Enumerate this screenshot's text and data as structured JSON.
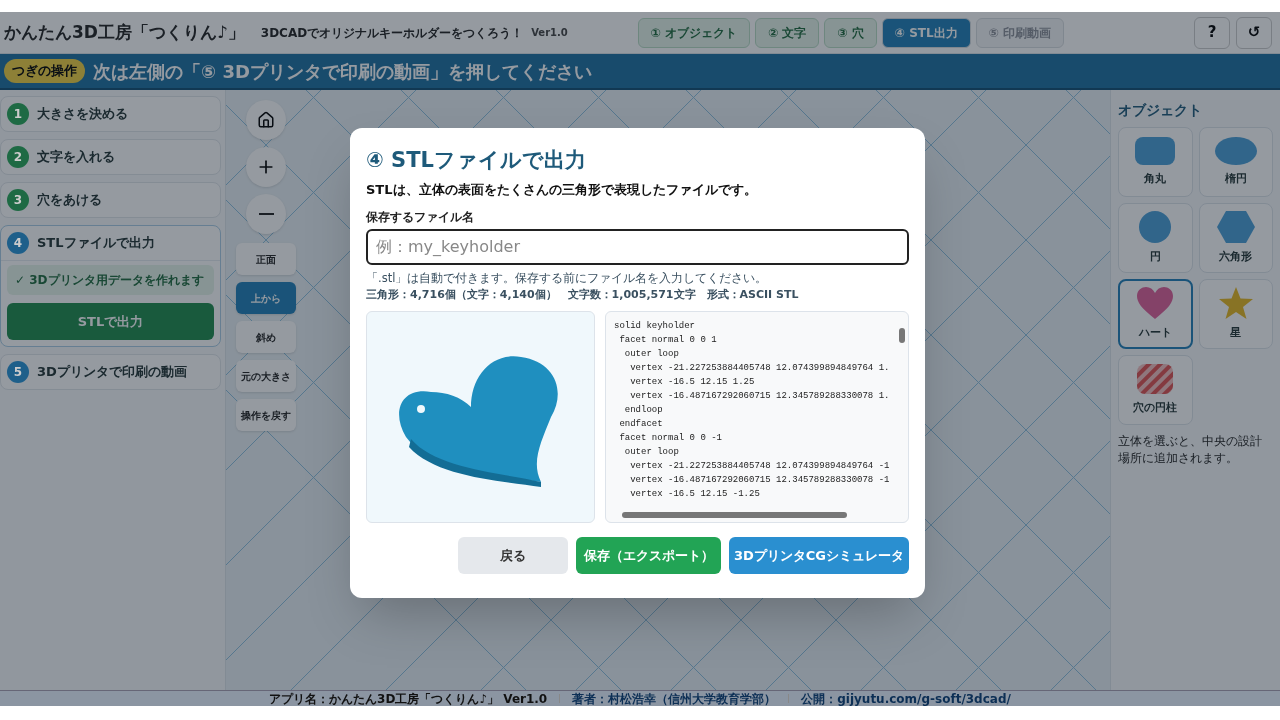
{
  "header": {
    "title": "かんたん3D工房「つくりん♪」",
    "subtitle": "3DCADでオリジナルキーホルダーをつくろう！",
    "version": "Ver1.0",
    "tabs": [
      {
        "label": "① オブジェクト",
        "selected": false,
        "done": true
      },
      {
        "label": "② 文字",
        "selected": false,
        "done": true
      },
      {
        "label": "③ 穴",
        "selected": false,
        "done": true
      },
      {
        "label": "④ STL出力",
        "selected": true,
        "done": false
      },
      {
        "label": "⑤ 印刷動画",
        "selected": false,
        "done": false
      }
    ],
    "help": "?",
    "reset": "↺"
  },
  "banner": {
    "badge": "つぎの操作",
    "message": "次は左側の「⑤ 3Dプリンタで印刷の動画」を押してください"
  },
  "steps": [
    {
      "number": "1",
      "label": "大きさを決める",
      "color": "#1e6a44",
      "expanded": false
    },
    {
      "number": "2",
      "label": "文字を入れる",
      "color": "#1e6a44",
      "expanded": false
    },
    {
      "number": "3",
      "label": "穴をあける",
      "color": "#1e6a44",
      "expanded": false
    },
    {
      "number": "4",
      "label": "STLファイルで出力",
      "color": "#1e5f8a",
      "expanded": true,
      "note": "✓ 3Dプリンタ用データを作れます",
      "button": "STLで出力"
    },
    {
      "number": "5",
      "label": "3Dプリンタで印刷の動画",
      "color": "#1e5f8a",
      "expanded": false
    }
  ],
  "view_controls": [
    {
      "label": "正面",
      "selected": false
    },
    {
      "label": "上から",
      "selected": true
    },
    {
      "label": "斜め",
      "selected": false
    },
    {
      "label": "元の大きさ",
      "selected": false
    },
    {
      "label": "操作を戻す",
      "selected": false
    }
  ],
  "objects": {
    "title": "オブジェクト",
    "items": [
      {
        "label": "角丸",
        "kind": "rounded",
        "selected": false
      },
      {
        "label": "楕円",
        "kind": "ellipse",
        "selected": false
      },
      {
        "label": "円",
        "kind": "circle",
        "selected": false
      },
      {
        "label": "六角形",
        "kind": "hexagon",
        "selected": false
      },
      {
        "label": "ハート",
        "kind": "heart",
        "selected": true
      },
      {
        "label": "星",
        "kind": "star",
        "selected": false
      },
      {
        "label": "穴の円柱",
        "kind": "hole",
        "selected": false
      }
    ],
    "help": "立体を選ぶと、中央の設計場所に追加されます。"
  },
  "dialog": {
    "title": "④ STLファイルで出力",
    "description": "STLは、立体の表面をたくさんの三角形で表現したファイルです。",
    "field_label": "保存するファイル名",
    "placeholder": "例：my_keyholder",
    "hint": "「.stl」は自動で付きます。保存する前にファイル名を入力してください。",
    "stats": "三角形：4,716個（文字：4,140個）　文字数：1,005,571文字　形式：ASCII STL",
    "stl_lines": [
      "solid keyholder",
      " facet normal 0 0 1",
      "  outer loop",
      "   vertex -21.227253884405748 12.074399894849764 1.",
      "   vertex -16.5 12.15 1.25",
      "   vertex -16.487167292060715 12.345789288330078 1.",
      "  endloop",
      " endfacet",
      " facet normal 0 0 -1",
      "  outer loop",
      "   vertex -21.227253884405748 12.074399894849764 -1",
      "   vertex -16.487167292060715 12.345789288330078 -1",
      "   vertex -16.5 12.15 -1.25"
    ],
    "buttons": [
      {
        "label": "戻る",
        "kind": "back"
      },
      {
        "label": "保存（エクスポート）",
        "kind": "save"
      },
      {
        "label": "3DプリンタCGシミュレータ",
        "kind": "simulator"
      }
    ]
  },
  "footer": [
    "アプリ名：かんたん3D工房「つくりん♪」 Ver1.0",
    "著者：村松浩幸（信州大学教育学部）",
    "公開：gijyutu.com/g-soft/3dcad/"
  ]
}
